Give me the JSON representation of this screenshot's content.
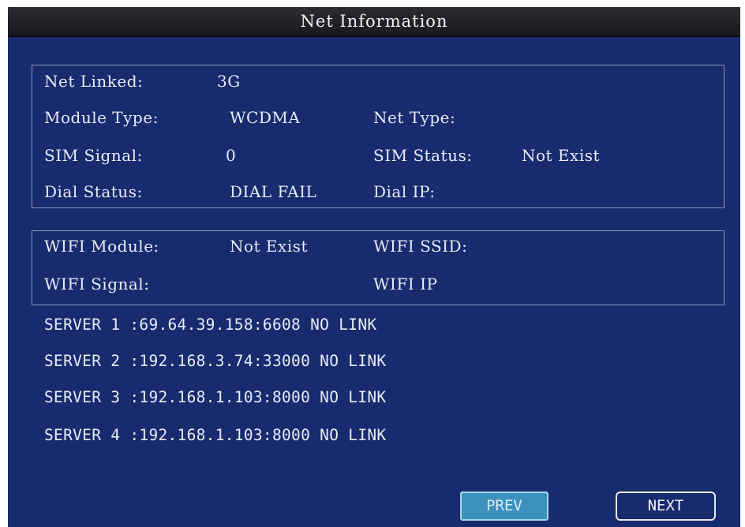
{
  "window": {
    "title": "Net Information"
  },
  "net": {
    "net_linked_label": "Net Linked:",
    "net_linked_value": "3G",
    "module_type_label": "Module Type:",
    "module_type_value": "WCDMA",
    "net_type_label": "Net Type:",
    "net_type_value": "",
    "sim_signal_label": "SIM Signal:",
    "sim_signal_value": "0",
    "sim_status_label": "SIM Status:",
    "sim_status_value": "Not Exist",
    "dial_status_label": "Dial Status:",
    "dial_status_value": "DIAL FAIL",
    "dial_ip_label": "Dial IP:",
    "dial_ip_value": ""
  },
  "wifi": {
    "module_label": "WIFI Module:",
    "module_value": "Not Exist",
    "ssid_label": "WIFI SSID:",
    "ssid_value": "",
    "signal_label": "WIFI Signal:",
    "signal_value": "",
    "ip_label": "WIFI IP",
    "ip_value": ""
  },
  "servers": [
    {
      "text": "SERVER 1 :69.64.39.158:6608 NO LINK"
    },
    {
      "text": "SERVER 2 :192.168.3.74:33000 NO LINK"
    },
    {
      "text": "SERVER 3 :192.168.1.103:8000 NO LINK"
    },
    {
      "text": "SERVER 4 :192.168.1.103:8000 NO LINK"
    }
  ],
  "buttons": {
    "prev_label": "PREV",
    "next_label": "NEXT"
  },
  "colors": {
    "background": "#172b6e",
    "text": "#e8ebf5",
    "title_bar": "#2c2c30",
    "selected_button": "#3c92bd"
  }
}
